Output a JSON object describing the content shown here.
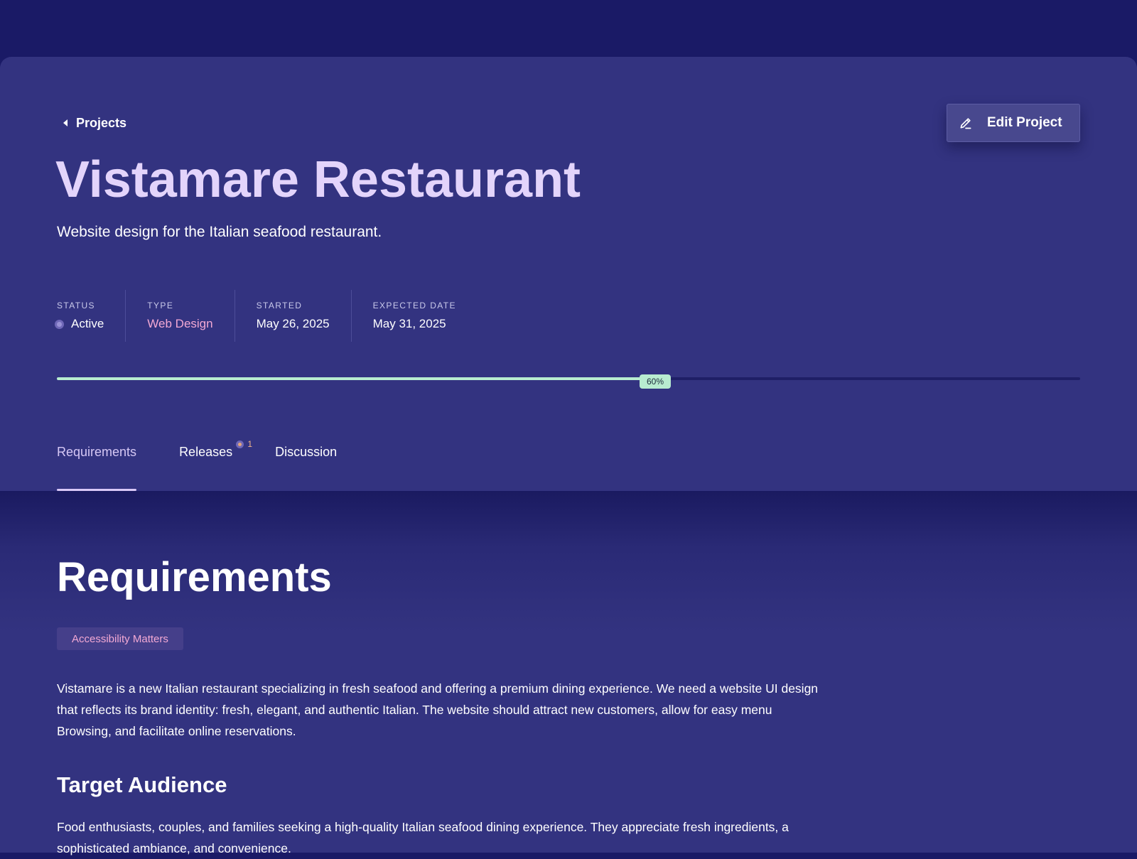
{
  "header": {
    "back_label": "Projects",
    "edit_label": "Edit Project",
    "title": "Vistamare Restaurant",
    "subtitle": "Website design for the Italian seafood restaurant."
  },
  "meta": {
    "status": {
      "label": "STATUS",
      "value": "Active"
    },
    "type": {
      "label": "TYPE",
      "value": "Web Design"
    },
    "started": {
      "label": "STARTED",
      "value": "May 26, 2025"
    },
    "expected": {
      "label": "EXPECTED DATE",
      "value": "May 31, 2025"
    }
  },
  "progress": {
    "percent": 60,
    "label": "60%"
  },
  "tabs": [
    {
      "label": "Requirements",
      "active": true
    },
    {
      "label": "Releases",
      "badge": "1"
    },
    {
      "label": "Discussion"
    }
  ],
  "content": {
    "title": "Requirements",
    "tag": "Accessibility Matters",
    "intro": "Vistamare is a new Italian restaurant specializing in fresh seafood and offering a premium dining experience. We need a website UI design that reflects its brand identity: fresh, elegant, and authentic Italian. The website should attract new customers, allow for easy menu Browsing, and facilitate online reservations.",
    "audience_heading": "Target Audience",
    "audience_text": "Food enthusiasts, couples, and families seeking a high-quality Italian seafood dining experience. They appreciate fresh ingredients, a sophisticated ambiance, and convenience."
  },
  "colors": {
    "background": "#1a1a66",
    "card": "#333380",
    "title": "#e3d4fb",
    "accent_pink": "#f3a9d4",
    "progress": "#b8ecd0",
    "badge": "#e3a57a"
  },
  "icons": {
    "back": "caret-left-icon",
    "edit": "pencil-icon",
    "status": "status-dot-icon"
  }
}
